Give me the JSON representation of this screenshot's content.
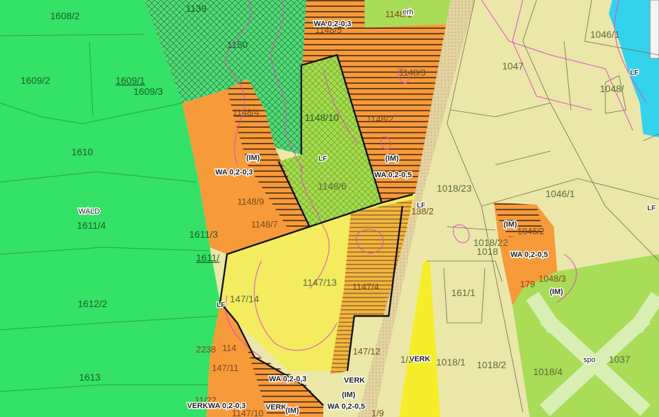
{
  "map": {
    "colors": {
      "forest": "#33e266",
      "residential": "#f79a3a",
      "mixed_zone": "#f2ec5e",
      "traffic": "#f6ed2a",
      "agriculture": "#ebe7a9",
      "green_area": "#a9dc57",
      "water": "#33d3ee",
      "road": "#e4d3a0",
      "boundary": "#111111",
      "contour": "#e24ac4"
    },
    "parcels": [
      {
        "id": "p1608_2",
        "text": "1608/2"
      },
      {
        "id": "p1609_2",
        "text": "1609/2"
      },
      {
        "id": "p1609_1",
        "text": "1609/1"
      },
      {
        "id": "p1609_3",
        "text": "1609/3"
      },
      {
        "id": "p1610",
        "text": "1610"
      },
      {
        "id": "p1611_4",
        "text": "1611/4"
      },
      {
        "id": "p1611_3",
        "text": "1611/3"
      },
      {
        "id": "p1611_x",
        "text": "1611/"
      },
      {
        "id": "p1612_2",
        "text": "1612/2"
      },
      {
        "id": "p1613",
        "text": "1613"
      },
      {
        "id": "p1139",
        "text": "1139"
      },
      {
        "id": "p1150",
        "text": "1150"
      },
      {
        "id": "p1148_5",
        "text": "1148/5"
      },
      {
        "id": "p1148_1",
        "text": "1148/1"
      },
      {
        "id": "p1148_3",
        "text": "1148/3"
      },
      {
        "id": "p1148_2",
        "text": "1148/2"
      },
      {
        "id": "p1148_10",
        "text": "1148/10"
      },
      {
        "id": "p1148_6",
        "text": "1148/6"
      },
      {
        "id": "p1148_9",
        "text": "1148/9"
      },
      {
        "id": "p1148_7",
        "text": "1148/7"
      },
      {
        "id": "p1148_4",
        "text": "1148/4"
      },
      {
        "id": "p1147_13",
        "text": "1147/13"
      },
      {
        "id": "p1147_14",
        "text": "147/14"
      },
      {
        "id": "p1147_4",
        "text": "1147/4"
      },
      {
        "id": "p1147_12",
        "text": "147/12"
      },
      {
        "id": "p1147_11",
        "text": "147/11"
      },
      {
        "id": "p1147_10",
        "text": "1147/10"
      },
      {
        "id": "p2238",
        "text": "2238"
      },
      {
        "id": "p114",
        "text": "114"
      },
      {
        "id": "p11_22",
        "text": "11/22"
      },
      {
        "id": "p1018_23",
        "text": "1018/23"
      },
      {
        "id": "p1018_22",
        "text": "1018/22"
      },
      {
        "id": "p1018_x",
        "text": "1018"
      },
      {
        "id": "p1018_1",
        "text": "1018/1"
      },
      {
        "id": "p1018_2",
        "text": "1018/2"
      },
      {
        "id": "p1018_4",
        "text": "1018/4"
      },
      {
        "id": "p1047",
        "text": "1047"
      },
      {
        "id": "p1046_1",
        "text": "1046/1"
      },
      {
        "id": "p1046_1b",
        "text": "1046/1"
      },
      {
        "id": "p1048_x",
        "text": "1048/"
      },
      {
        "id": "p1037",
        "text": "1037"
      },
      {
        "id": "p179",
        "text": "179"
      },
      {
        "id": "p161_1",
        "text": "161/1"
      },
      {
        "id": "p1046_2",
        "text": "1046/2"
      },
      {
        "id": "p1048_3",
        "text": "1048/3"
      },
      {
        "id": "p138_2",
        "text": "138/2"
      },
      {
        "id": "p1_2",
        "text": "1/2"
      },
      {
        "id": "p1_9",
        "text": "1/9"
      }
    ],
    "zone_labels": [
      {
        "id": "z_wald",
        "text": "WALD"
      },
      {
        "id": "z_wa1",
        "text": "WA 0,2-0,3"
      },
      {
        "id": "z_wa2",
        "text": "WA 0,2-0,3"
      },
      {
        "id": "z_wa3",
        "text": "WA 0,2-0,5"
      },
      {
        "id": "z_wa4",
        "text": "WA 0,2-0,5"
      },
      {
        "id": "z_wa5",
        "text": "WA 0,2-0,3"
      },
      {
        "id": "z_verkwa",
        "text": "VERKWA 0,2-0,3"
      },
      {
        "id": "z_wa6",
        "text": "WA 0,2-0,5"
      },
      {
        "id": "z_verk1",
        "text": "VERK"
      },
      {
        "id": "z_verk2",
        "text": "VERK"
      },
      {
        "id": "z_verk3",
        "text": "VERK"
      },
      {
        "id": "z_im1",
        "text": "(IM)"
      },
      {
        "id": "z_im2",
        "text": "(IM)"
      },
      {
        "id": "z_im3",
        "text": "(IM)"
      },
      {
        "id": "z_im4",
        "text": "(IM)"
      },
      {
        "id": "z_im5",
        "text": "(IM)"
      },
      {
        "id": "z_im6",
        "text": "(IM)"
      },
      {
        "id": "z_erh",
        "text": "erh"
      },
      {
        "id": "z_spo",
        "text": "spo"
      }
    ],
    "lf_labels": [
      {
        "id": "lf1",
        "text": "LF"
      },
      {
        "id": "lf2",
        "text": "LF"
      },
      {
        "id": "lf3",
        "text": "LF"
      },
      {
        "id": "lf4",
        "text": "LF"
      },
      {
        "id": "lf5",
        "text": "LF"
      }
    ]
  }
}
